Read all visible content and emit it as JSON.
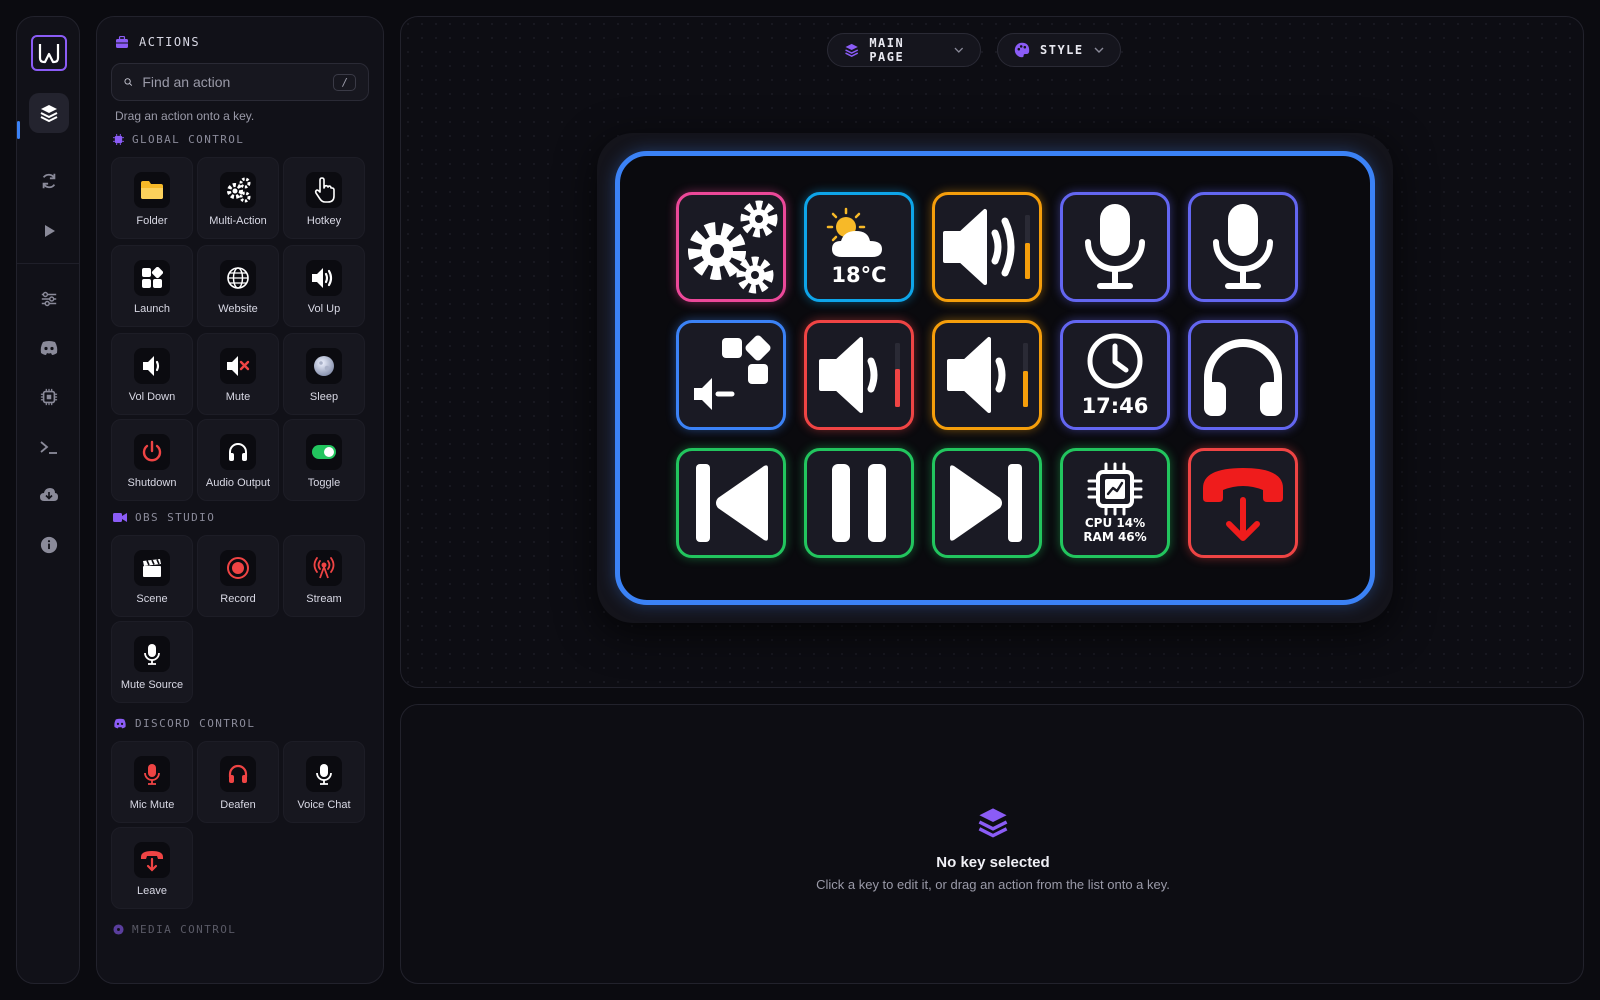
{
  "sidebar": {
    "logo": "w-logo-icon",
    "items": [
      {
        "icon": "layers-icon",
        "active": true
      },
      {
        "icon": "refresh-icon"
      },
      {
        "icon": "play-icon"
      },
      {
        "icon": "sliders-icon"
      },
      {
        "icon": "discord-icon"
      },
      {
        "icon": "cpu-icon"
      },
      {
        "icon": "terminal-icon"
      },
      {
        "icon": "cloud-download-icon"
      },
      {
        "icon": "info-icon"
      }
    ]
  },
  "actions_panel": {
    "title": "ACTIONS",
    "search_placeholder": "Find an action",
    "search_shortcut": "/",
    "hint": "Drag an action onto a key.",
    "sections": [
      {
        "label": "GLOBAL CONTROL",
        "items": [
          "Folder",
          "Multi-Action",
          "Hotkey",
          "Launch",
          "Website",
          "Vol Up",
          "Vol Down",
          "Mute",
          "Sleep",
          "Shutdown",
          "Audio Output",
          "Toggle"
        ]
      },
      {
        "label": "OBS STUDIO",
        "items": [
          "Scene",
          "Record",
          "Stream",
          "Mute Source"
        ]
      },
      {
        "label": "DISCORD CONTROL",
        "items": [
          "Mic Mute",
          "Deafen",
          "Voice Chat",
          "Leave"
        ]
      },
      {
        "label": "MEDIA CONTROL",
        "items": []
      }
    ]
  },
  "toolbar": {
    "page_selector": "MAIN PAGE",
    "style_selector": "STYLE"
  },
  "deck": {
    "accent": "#3b82f6",
    "keys": [
      {
        "action": "multi-action",
        "border": "#ec4899"
      },
      {
        "action": "weather",
        "border": "#0ea5e9",
        "text": "18°C"
      },
      {
        "action": "vol-up",
        "border": "#f59e0b"
      },
      {
        "action": "mic",
        "border": "#6366f1"
      },
      {
        "action": "mic",
        "border": "#6366f1"
      },
      {
        "action": "audio-output",
        "border": "#3b82f6"
      },
      {
        "action": "vol-down",
        "border": "#ef4444"
      },
      {
        "action": "vol-down",
        "border": "#f59e0b"
      },
      {
        "action": "clock",
        "border": "#6366f1",
        "text": "17:46"
      },
      {
        "action": "headphones",
        "border": "#6366f1"
      },
      {
        "action": "previous",
        "border": "#22c55e"
      },
      {
        "action": "pause",
        "border": "#22c55e"
      },
      {
        "action": "next",
        "border": "#22c55e"
      },
      {
        "action": "system-stats",
        "border": "#22c55e",
        "line1": "CPU 14%",
        "line2": "RAM 46%"
      },
      {
        "action": "leave-call",
        "border": "#ef4444"
      }
    ]
  },
  "inspector": {
    "empty_title": "No key selected",
    "empty_subtitle": "Click a key to edit it, or drag an action from the list onto a key."
  }
}
